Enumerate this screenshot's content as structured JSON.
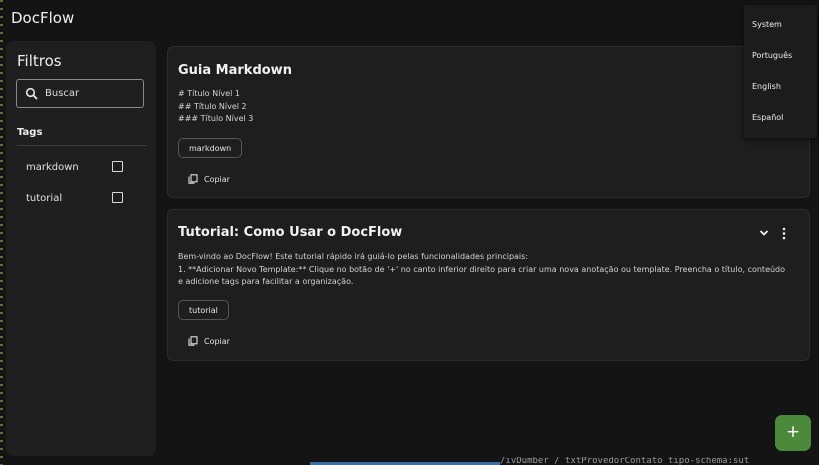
{
  "app": {
    "title": "DocFlow"
  },
  "sidebar": {
    "title": "Filtros",
    "search": {
      "placeholder": "Buscar"
    },
    "tags_title": "Tags",
    "tags": [
      {
        "label": "markdown",
        "checked": false
      },
      {
        "label": "tutorial",
        "checked": false
      }
    ]
  },
  "cards": [
    {
      "title": "Guia Markdown",
      "body": [
        "# Título Nível 1",
        "## Título Nível 2",
        "### Título Nível 3"
      ],
      "tag": "markdown",
      "copy_label": "Copiar"
    },
    {
      "title": "Tutorial: Como Usar o DocFlow",
      "body": [
        "Bem-vindo ao DocFlow! Este tutorial rápido irá guiá-lo pelas funcionalidades principais:",
        "1.  **Adicionar Novo Template:** Clique no botão de '+' no canto inferior direito para criar uma nova anotação ou template. Preencha o título, conteúdo e adicione tags para facilitar a organização."
      ],
      "tag": "tutorial",
      "copy_label": "Copiar"
    }
  ],
  "language_menu": {
    "items": [
      "System",
      "Português",
      "English",
      "Español"
    ]
  },
  "fab": {
    "label": "+"
  },
  "terminal_snippet": "/ivDumber / txtProvedorContato tipo-schema:sut",
  "colors": {
    "background": "#141414",
    "surface": "#1e1e1e",
    "fab": "#4a8a3a"
  }
}
